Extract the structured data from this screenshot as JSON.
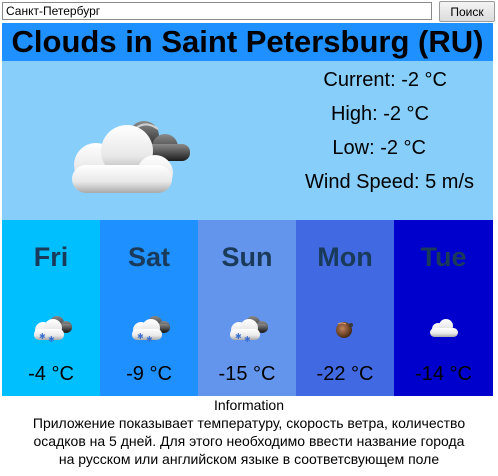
{
  "search": {
    "value": "Санкт-Петербург",
    "button_label": "Поиск"
  },
  "header": {
    "title": "Clouds in Saint Petersburg (RU)",
    "bg_color": "#1e90ff"
  },
  "current": {
    "icon": "clouds-icon",
    "current_label": "Current: -2 °C",
    "high_label": "High: -2 °C",
    "low_label": "Low: -2 °C",
    "wind_label": "Wind Speed: 5 m/s",
    "bg_color": "#87cefa"
  },
  "forecast": [
    {
      "day": "Fri",
      "temp": "-4 °C",
      "icon": "snow-clouds-icon",
      "bg_color": "#00bfff"
    },
    {
      "day": "Sat",
      "temp": "-9 °C",
      "icon": "snow-clouds-icon",
      "bg_color": "#1e90ff"
    },
    {
      "day": "Sun",
      "temp": "-15 °C",
      "icon": "snow-clouds-icon",
      "bg_color": "#6495ed"
    },
    {
      "day": "Mon",
      "temp": "-22 °C",
      "icon": "moon-haze-icon",
      "bg_color": "#4169e1"
    },
    {
      "day": "Tue",
      "temp": "-14 °C",
      "icon": "cloud-icon",
      "bg_color": "#0000cd"
    }
  ],
  "info": {
    "title": "Information",
    "line1": "Приложение показывает температуру, скорость ветра, количество",
    "line2": "осадков на 5 дней. Для этого необходимо ввести название города",
    "line3": "на русском или английском языке в соответсвующем поле"
  }
}
